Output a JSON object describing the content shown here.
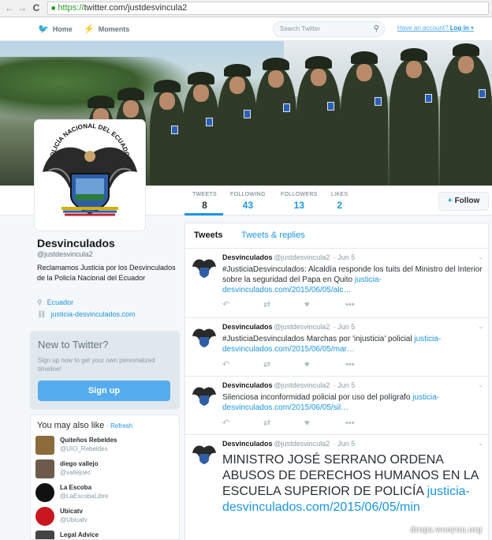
{
  "browser": {
    "url_https": "https://",
    "url_rest": "twitter.com/justdesvincula2"
  },
  "topnav": {
    "home": "Home",
    "moments": "Moments",
    "search_placeholder": "Search Twitter",
    "login_prefix": "Have an account?",
    "login": "Log in"
  },
  "profile": {
    "name": "Desvinculados",
    "handle": "@justdesvincula2",
    "bio": "Reclamamos Justicia por los Desvinculados de la Policía Nacional del Ecuador",
    "location": "Ecuador",
    "url": "justicia-desvinculados.com",
    "avatar_text": "POLICÍA NACIONAL DEL ECUADOR"
  },
  "stats": [
    {
      "label": "TWEETS",
      "value": "8"
    },
    {
      "label": "FOLLOWING",
      "value": "43"
    },
    {
      "label": "FOLLOWERS",
      "value": "13"
    },
    {
      "label": "LIKES",
      "value": "2"
    }
  ],
  "follow_label": "Follow",
  "signup": {
    "title": "New to Twitter?",
    "desc": "Sign up now to get your own personalized timeline!",
    "button": "Sign up"
  },
  "suggestions": {
    "title": "You may also like",
    "refresh": "· Refresh",
    "items": [
      {
        "name": "Quiteños Rebeldes",
        "handle": "@UIO_Rebeldes"
      },
      {
        "name": "diego vallejo",
        "handle": "@vallejoec"
      },
      {
        "name": "La Escoba",
        "handle": "@LaEscobaLibre"
      },
      {
        "name": "Ubicatv",
        "handle": "@Ubicatv"
      },
      {
        "name": "Legal Advice",
        "handle": ""
      }
    ]
  },
  "tabs": {
    "tweets": "Tweets",
    "replies": "Tweets & replies"
  },
  "tweets": [
    {
      "name": "Desvinculados",
      "handle": "@justdesvincula2",
      "date": "· Jun 5",
      "text": "#JusticiaDesvinculados: Alcaldía responde los tuits del Ministro del Interior sobre la seguridad del Papa en Quito ",
      "link": "justicia-desvinculados.com/2015/06/05/alc…"
    },
    {
      "name": "Desvinculados",
      "handle": "@justdesvincula2",
      "date": "· Jun 5",
      "text": "#JusticiaDesvinculados Marchas por 'injusticia' policial ",
      "link": "justicia-desvinculados.com/2015/06/05/mar…"
    },
    {
      "name": "Desvinculados",
      "handle": "@justdesvincula2",
      "date": "· Jun 5",
      "text": "Silenciosa inconformidad policial por uso del polígrafo ",
      "link": "justicia-desvinculados.com/2015/06/05/sil…"
    },
    {
      "name": "Desvinculados",
      "handle": "@justdesvincula2",
      "date": "· Jun 5",
      "text": "MINISTRO JOSÉ SERRANO ORDENA ABUSOS DE DERECHOS HUMANOS EN LA ESCUELA SUPERIOR DE POLICÍA ",
      "link": "justicia-desvinculados.com/2015/06/05/min"
    }
  ],
  "watermark": "drops.wooyun.org"
}
